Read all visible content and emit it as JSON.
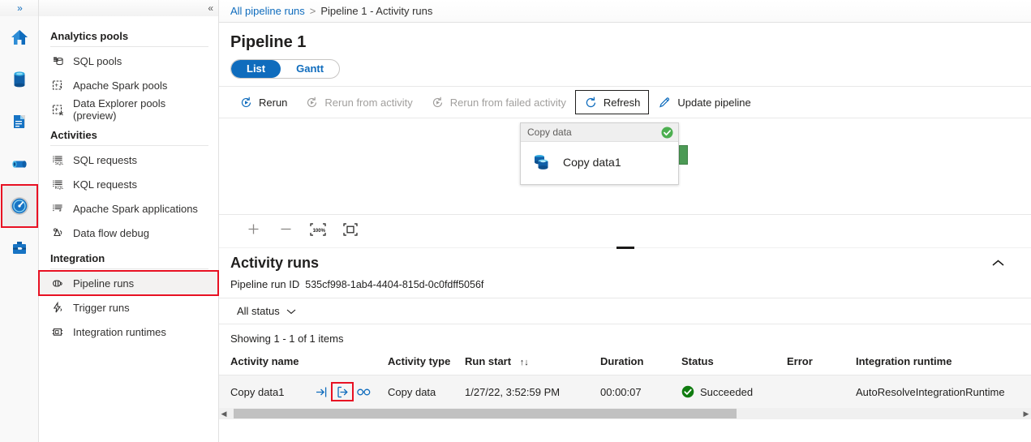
{
  "rail": {
    "expand_icon": "chevron-double-right-icon",
    "items": [
      {
        "name": "home",
        "icon": "home-icon",
        "selected": false
      },
      {
        "name": "data",
        "icon": "database-icon",
        "selected": false
      },
      {
        "name": "develop",
        "icon": "document-icon",
        "selected": false
      },
      {
        "name": "integrate",
        "icon": "pipeline-icon",
        "selected": false
      },
      {
        "name": "monitor",
        "icon": "gauge-icon",
        "selected": true
      },
      {
        "name": "manage",
        "icon": "toolbox-icon",
        "selected": false
      }
    ],
    "selected_outline_color": "#e81123"
  },
  "nav": {
    "collapse_icon": "chevron-double-left-icon",
    "groups": [
      {
        "title": "Analytics pools",
        "items": [
          {
            "label": "SQL pools",
            "icon": "sql-pool-icon",
            "selected": false
          },
          {
            "label": "Apache Spark pools",
            "icon": "spark-pool-icon",
            "selected": false
          },
          {
            "label": "Data Explorer pools (preview)",
            "icon": "data-explorer-pool-icon",
            "selected": false
          }
        ]
      },
      {
        "title": "Activities",
        "items": [
          {
            "label": "SQL requests",
            "icon": "sql-request-icon",
            "selected": false
          },
          {
            "label": "KQL requests",
            "icon": "kql-request-icon",
            "selected": false
          },
          {
            "label": "Apache Spark applications",
            "icon": "spark-application-icon",
            "selected": false
          },
          {
            "label": "Data flow debug",
            "icon": "data-flow-debug-icon",
            "selected": false
          }
        ]
      },
      {
        "title": "Integration",
        "items": [
          {
            "label": "Pipeline runs",
            "icon": "pipeline-runs-icon",
            "selected": true
          },
          {
            "label": "Trigger runs",
            "icon": "trigger-runs-icon",
            "selected": false
          },
          {
            "label": "Integration runtimes",
            "icon": "integration-runtimes-icon",
            "selected": false
          }
        ]
      }
    ]
  },
  "breadcrumb": {
    "root": "All pipeline runs",
    "separator": ">",
    "current": "Pipeline 1 - Activity runs"
  },
  "page": {
    "title": "Pipeline 1"
  },
  "view_toggle": {
    "options": [
      "List",
      "Gantt"
    ],
    "selected": "List",
    "accent_color": "#0f6cbd"
  },
  "toolbar": {
    "buttons": [
      {
        "label": "Rerun",
        "icon": "rerun-icon",
        "disabled": false,
        "focused": false
      },
      {
        "label": "Rerun from activity",
        "icon": "rerun-icon",
        "disabled": true,
        "focused": false
      },
      {
        "label": "Rerun from failed activity",
        "icon": "rerun-icon",
        "disabled": true,
        "focused": false
      },
      {
        "label": "Refresh",
        "icon": "refresh-icon",
        "disabled": false,
        "focused": true
      },
      {
        "label": "Update pipeline",
        "icon": "pencil-icon",
        "disabled": false,
        "focused": false
      }
    ]
  },
  "canvas": {
    "node": {
      "header_label": "Copy data",
      "status_icon": "success-check-icon",
      "status_color": "#4caf50",
      "body_label": "Copy data1",
      "body_icon": "copy-data-icon",
      "port_color": "#4c9a55"
    },
    "zoom_controls": [
      {
        "name": "zoom-in",
        "icon": "plus-icon"
      },
      {
        "name": "zoom-out",
        "icon": "minus-icon"
      },
      {
        "name": "zoom-to-100",
        "icon": "zoom-100-icon",
        "label": "100%"
      },
      {
        "name": "zoom-to-fit",
        "icon": "fit-to-screen-icon"
      }
    ]
  },
  "activity_runs": {
    "title": "Activity runs",
    "collapse_icon": "chevron-up-icon",
    "run_id_label": "Pipeline run ID",
    "run_id_value": "535cf998-1ab4-4404-815d-0c0fdff5056f",
    "status_filter": {
      "label": "All status",
      "icon": "chevron-down-icon"
    },
    "showing": "Showing 1 - 1 of 1 items",
    "columns": [
      "Activity name",
      "Activity type",
      "Run start",
      "Duration",
      "Status",
      "Error",
      "Integration runtime"
    ],
    "sort_column": "Run start",
    "sort_icon": "sort-updown-icon",
    "rows": [
      {
        "activity_name": "Copy data1",
        "row_icons": [
          {
            "name": "input-details-icon",
            "highlighted": false
          },
          {
            "name": "output-details-icon",
            "highlighted": true
          },
          {
            "name": "details-glasses-icon",
            "highlighted": false
          }
        ],
        "activity_type": "Copy data",
        "run_start": "1/27/22, 3:52:59 PM",
        "duration": "00:00:07",
        "status": "Succeeded",
        "status_icon": "success-check-icon",
        "status_color": "#107c10",
        "error": "",
        "integration_runtime": "AutoResolveIntegrationRuntime"
      }
    ],
    "scrollbar": {
      "left_arrow": "caret-left-icon",
      "right_arrow": "caret-right-icon"
    }
  }
}
